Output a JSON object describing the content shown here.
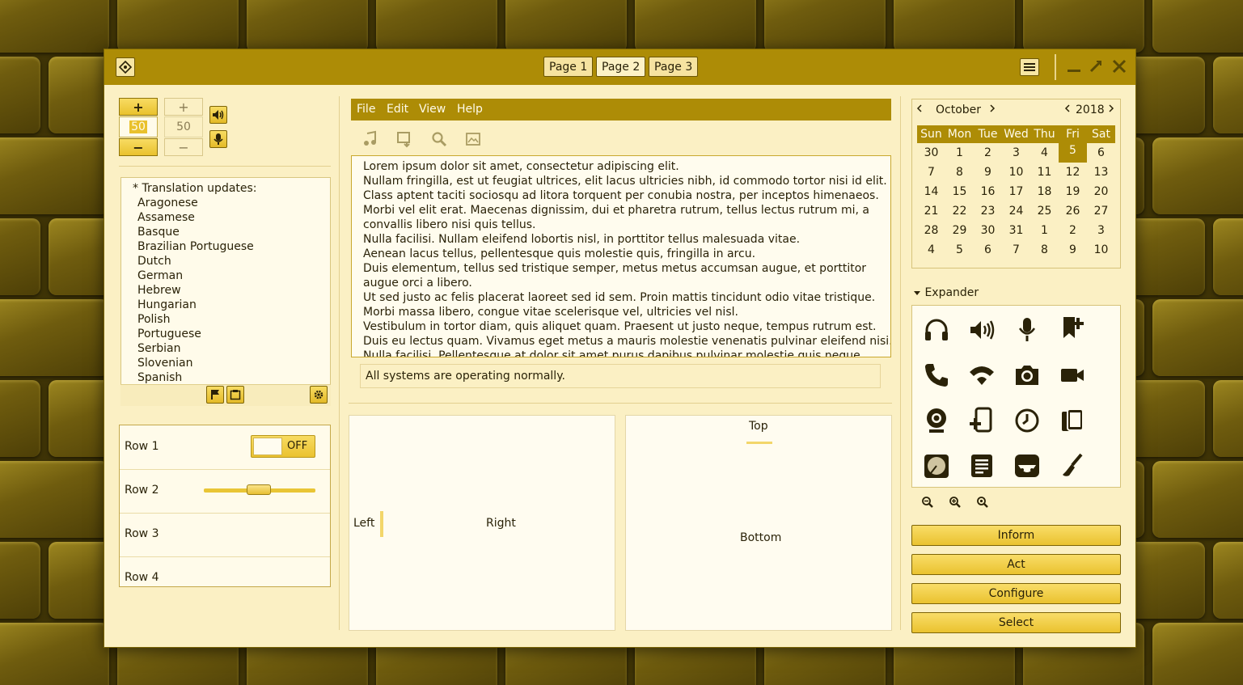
{
  "titlebar": {
    "pages": [
      "Page 1",
      "Page 2",
      "Page 3"
    ],
    "active_page": "Page 2"
  },
  "spinners": {
    "active_value": "50",
    "inactive_value": "50",
    "plus": "+",
    "minus": "−"
  },
  "list": {
    "header": "* Translation updates:",
    "items": [
      "Aragonese",
      "Assamese",
      "Basque",
      "Brazilian Portuguese",
      "Dutch",
      "German",
      "Hebrew",
      "Hungarian",
      "Polish",
      "Portuguese",
      "Serbian",
      "Slovenian",
      "Spanish"
    ]
  },
  "rows": {
    "labels": [
      "Row 1",
      "Row 2",
      "Row 3",
      "Row 4"
    ],
    "switch_text": "OFF",
    "slider_fraction": 0.49
  },
  "menu": {
    "items": [
      "File",
      "Edit",
      "View",
      "Help"
    ]
  },
  "text": {
    "lines": [
      "Lorem ipsum dolor sit amet, consectetur adipiscing elit.",
      "Nullam fringilla, est ut feugiat ultrices, elit lacus ultricies nibh, id commodo tortor nisi id elit.",
      "Class aptent taciti sociosqu ad litora torquent per conubia nostra, per inceptos himenaeos.",
      "Morbi vel elit erat. Maecenas dignissim, dui et pharetra rutrum, tellus lectus rutrum mi, a",
      "convallis libero nisi quis tellus.",
      "Nulla facilisi. Nullam eleifend lobortis nisl, in porttitor tellus malesuada vitae.",
      "Aenean lacus tellus, pellentesque quis molestie quis, fringilla in arcu.",
      "Duis elementum, tellus sed tristique semper, metus metus accumsan augue, et porttitor",
      "augue orci a libero.",
      "Ut sed justo ac felis placerat laoreet sed id sem. Proin mattis tincidunt odio vitae tristique.",
      "Morbi massa libero, congue vitae scelerisque vel, ultricies vel nisl.",
      "Vestibulum in tortor diam, quis aliquet quam. Praesent ut justo neque, tempus rutrum est.",
      "Duis eu lectus quam. Vivamus eget metus a mauris molestie venenatis pulvinar eleifend nisi.",
      "Nulla facilisi. Pellentesque at dolor sit amet purus dapibus pulvinar molestie quis neque."
    ],
    "status": "All systems are operating normally."
  },
  "panes": {
    "left": "Left",
    "right": "Right",
    "top": "Top",
    "bottom": "Bottom"
  },
  "calendar": {
    "month": "October",
    "year": "2018",
    "weekdays": [
      "Sun",
      "Mon",
      "Tue",
      "Wed",
      "Thu",
      "Fri",
      "Sat"
    ],
    "weeks": [
      [
        "30",
        "1",
        "2",
        "3",
        "4",
        "5",
        "6"
      ],
      [
        "7",
        "8",
        "9",
        "10",
        "11",
        "12",
        "13"
      ],
      [
        "14",
        "15",
        "16",
        "17",
        "18",
        "19",
        "20"
      ],
      [
        "21",
        "22",
        "23",
        "24",
        "25",
        "26",
        "27"
      ],
      [
        "28",
        "29",
        "30",
        "31",
        "1",
        "2",
        "3"
      ],
      [
        "4",
        "5",
        "6",
        "7",
        "8",
        "9",
        "10"
      ]
    ],
    "selected_day": "5"
  },
  "expander": {
    "label": "Expander",
    "icons": [
      "headphones-icon",
      "speaker-icon",
      "microphone-icon",
      "bookmark-add-icon",
      "phone-icon",
      "network-wireless-icon",
      "camera-icon",
      "video-camera-icon",
      "webcam-icon",
      "tablet-add-icon",
      "clock-icon",
      "copy-icon",
      "disk-icon",
      "document-icon",
      "face-icon",
      "brush-icon"
    ]
  },
  "actions": [
    "Inform",
    "Act",
    "Configure",
    "Select"
  ],
  "colors": {
    "accent": "#ad8c06",
    "button": "#f3d04a",
    "background": "#fbf0c4"
  }
}
